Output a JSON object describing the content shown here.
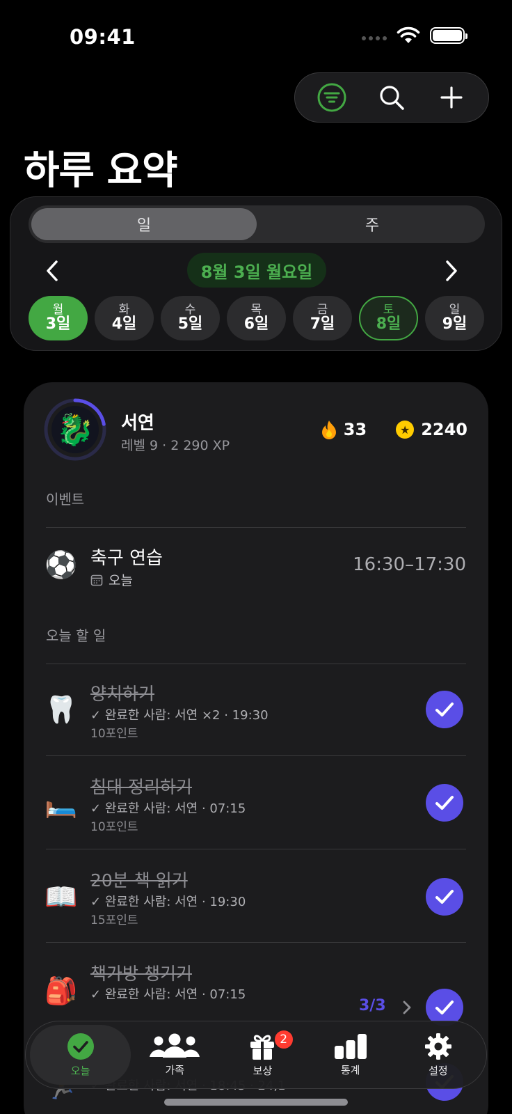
{
  "status_bar": {
    "time": "09:41"
  },
  "page_title": "하루 요약",
  "segment": {
    "day_label": "일",
    "week_label": "주"
  },
  "date_nav": {
    "current": "8월 3일 월요일"
  },
  "days": [
    {
      "weekday": "월",
      "date": "3일"
    },
    {
      "weekday": "화",
      "date": "4일"
    },
    {
      "weekday": "수",
      "date": "5일"
    },
    {
      "weekday": "목",
      "date": "6일"
    },
    {
      "weekday": "금",
      "date": "7일"
    },
    {
      "weekday": "토",
      "date": "8일"
    },
    {
      "weekday": "일",
      "date": "9일"
    }
  ],
  "user": {
    "name": "서연",
    "subtitle": "레벨 9 · 2 290 XP",
    "streak": "33",
    "points": "2240",
    "level_progress": 0.22
  },
  "events_label": "이벤트",
  "event": {
    "icon": "⚽",
    "title": "축구 연습",
    "when": "오늘",
    "time": "16:30–17:30"
  },
  "tasks_label": "오늘 할 일",
  "tasks": [
    {
      "icon": "🦷",
      "title": "양치하기",
      "done": "완료한 사람: 서연 ×2 · 19:30",
      "points": "10포인트"
    },
    {
      "icon": "🛏️",
      "title": "침대 정리하기",
      "done": "완료한 사람: 서연 · 07:15",
      "points": "10포인트"
    },
    {
      "icon": "📖",
      "title": "20분 책 읽기",
      "done": "완료한 사람: 서연 · 19:30",
      "points": "15포인트"
    },
    {
      "icon": "🎒",
      "title": "책가방 챙기기",
      "done": "완료한 사람: 서연 · 07:15",
      "points": "",
      "progress": "3/3"
    },
    {
      "icon": "🏃",
      "title": "",
      "done": "완료한 사람: 서연 · 18:45 · 24,1",
      "points": ""
    }
  ],
  "tabbar": {
    "today": "오늘",
    "family": "가족",
    "rewards": "보상",
    "rewards_badge": "2",
    "stats": "통계",
    "settings": "설정"
  },
  "colors": {
    "accent_green": "#43a843",
    "accent_purple": "#5a4ee6",
    "badge_red": "#ff3b30"
  }
}
